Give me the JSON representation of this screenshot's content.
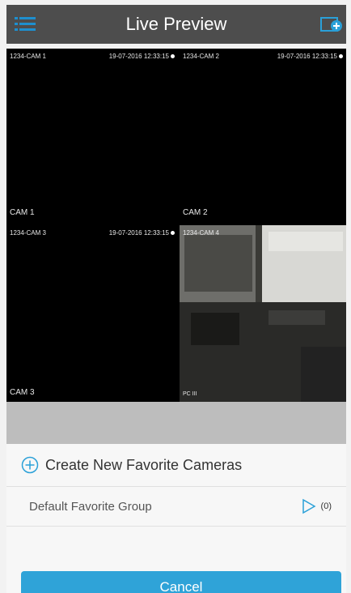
{
  "header": {
    "title": "Live Preview",
    "menu_icon": "list-menu-icon",
    "add_icon": "add-view-icon",
    "background": "#4d4d4d"
  },
  "cameras": [
    {
      "top_label": "1234-CAM 1",
      "timestamp": "19-07-2016 12:33:15",
      "bottom_label": "CAM 1"
    },
    {
      "top_label": "1234-CAM 2",
      "timestamp": "19-07-2016 12:33:15",
      "bottom_label": "CAM 2"
    },
    {
      "top_label": "1234-CAM 3",
      "timestamp": "19-07-2016 12:33:15",
      "bottom_label": "CAM 3"
    },
    {
      "top_label": "1234-CAM 4",
      "timestamp": "",
      "bottom_label": "PC III"
    }
  ],
  "sheet": {
    "create_label": "Create New Favorite Cameras",
    "group_label": "Default Favorite Group",
    "group_count": "(0)",
    "cancel_label": "Cancel",
    "accent": "#2fa3d8"
  }
}
